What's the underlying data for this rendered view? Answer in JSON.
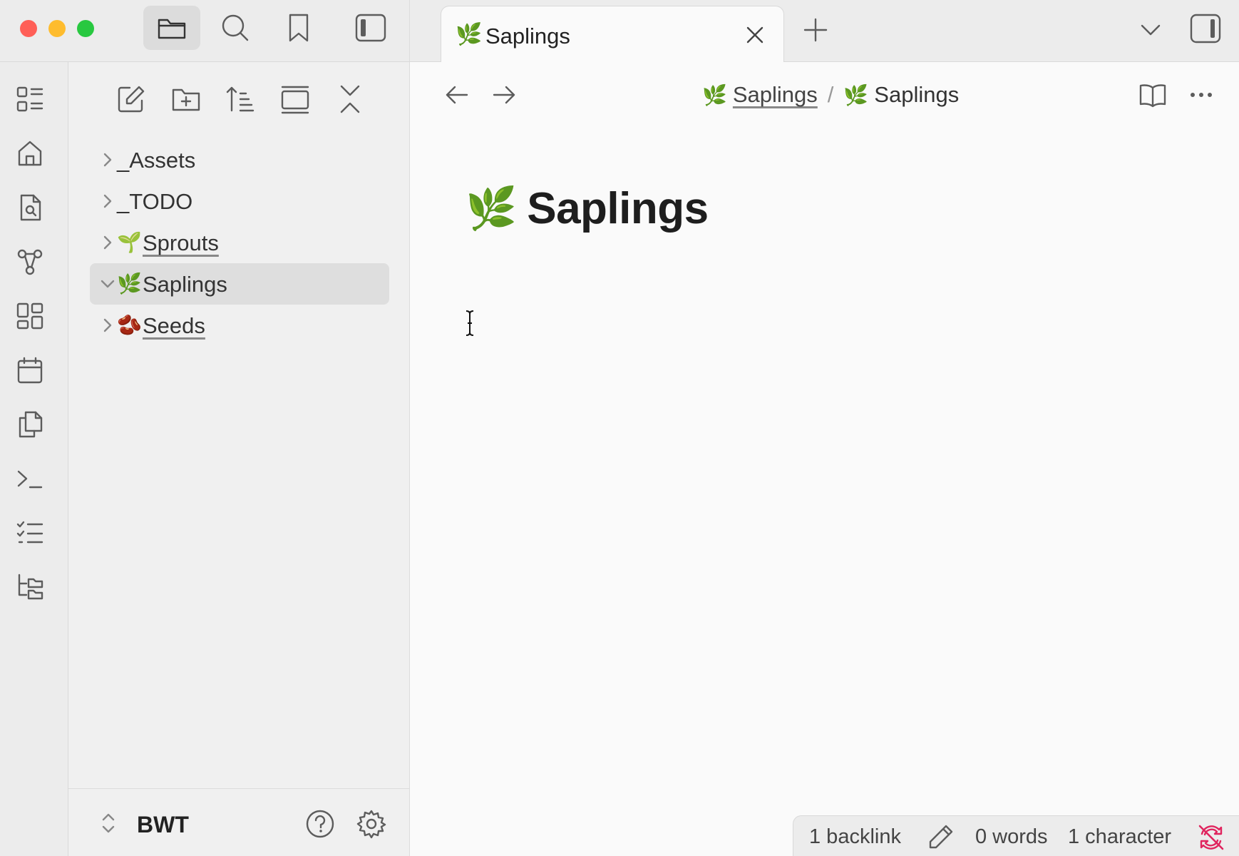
{
  "window": {
    "traffic_lights": {
      "close_color": "#ff5f57",
      "minimize_color": "#febc2e",
      "maximize_color": "#28c840"
    }
  },
  "toolbar": {
    "icons": [
      "folder-icon",
      "search-icon",
      "bookmark-icon",
      "sidebar-toggle-icon"
    ],
    "active_icon": "folder-icon"
  },
  "tabs": [
    {
      "emoji": "🌿",
      "label": "Saplings",
      "active": true
    }
  ],
  "ribbon": {
    "icons": [
      "dashboard-icon",
      "home-icon",
      "file-search-icon",
      "graph-icon",
      "grid-icon",
      "calendar-icon",
      "copy-icon",
      "terminal-icon",
      "checklist-icon",
      "folder-tree-icon"
    ]
  },
  "sidebar": {
    "tools": [
      "new-note-icon",
      "new-folder-icon",
      "sort-icon",
      "collapse-view-icon",
      "collapse-all-icon"
    ],
    "tree": [
      {
        "emoji": "",
        "label": "_Assets",
        "expanded": false,
        "underlined": false
      },
      {
        "emoji": "",
        "label": "_TODO",
        "expanded": false,
        "underlined": false
      },
      {
        "emoji": "🌱",
        "label": "Sprouts",
        "expanded": false,
        "underlined": true
      },
      {
        "emoji": "🌿",
        "label": "Saplings",
        "expanded": true,
        "underlined": false,
        "active": true
      },
      {
        "emoji": "🫘",
        "label": "Seeds",
        "expanded": false,
        "underlined": true
      }
    ],
    "vault": {
      "name": "BWT"
    }
  },
  "main": {
    "breadcrumb": {
      "parent_emoji": "🌿",
      "parent_label": "Saplings",
      "separator": "/",
      "current_emoji": "🌿",
      "current_label": "Saplings"
    },
    "document": {
      "title_emoji": "🌿",
      "title": "Saplings"
    }
  },
  "statusbar": {
    "backlinks": "1 backlink",
    "words": "0 words",
    "characters": "1 character",
    "sync_color": "#e0245e"
  }
}
